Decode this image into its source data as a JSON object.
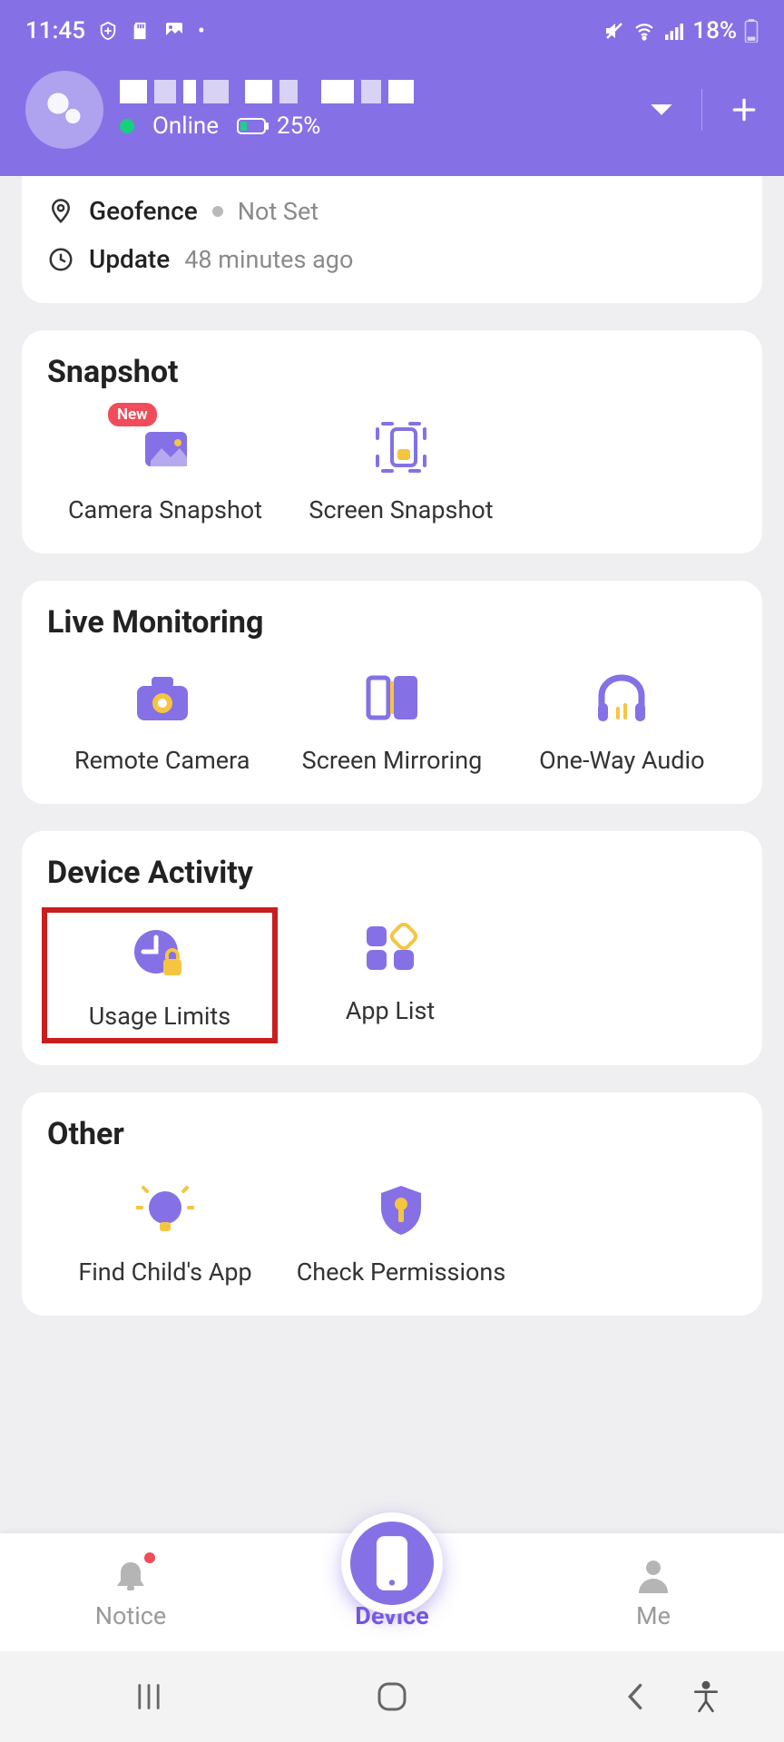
{
  "status": {
    "time": "11:45",
    "battery_pct": "18%"
  },
  "profile": {
    "online_label": "Online",
    "battery": "25%"
  },
  "info": {
    "geofence_label": "Geofence",
    "geofence_value": "Not Set",
    "update_label": "Update",
    "update_value": "48 minutes ago"
  },
  "snapshot": {
    "title": "Snapshot",
    "camera": "Camera Snapshot",
    "screen": "Screen Snapshot",
    "badge": "New"
  },
  "live": {
    "title": "Live Monitoring",
    "remote_camera": "Remote Camera",
    "screen_mirroring": "Screen Mirroring",
    "one_way_audio": "One-Way Audio"
  },
  "activity": {
    "title": "Device Activity",
    "usage_limits": "Usage Limits",
    "app_list": "App List"
  },
  "other": {
    "title": "Other",
    "find_child": "Find Child's App",
    "check_perms": "Check Permissions"
  },
  "tabs": {
    "notice": "Notice",
    "device": "Device",
    "me": "Me"
  }
}
